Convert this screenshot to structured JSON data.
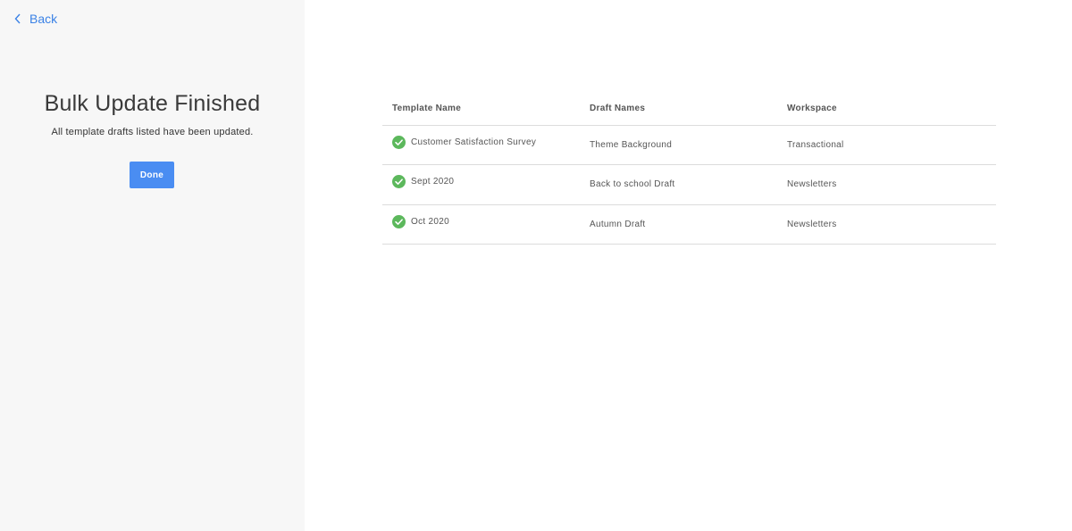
{
  "sidebar": {
    "back_label": "Back",
    "title": "Bulk Update Finished",
    "subtitle": "All template drafts listed have been updated.",
    "done_label": "Done"
  },
  "table": {
    "headers": [
      "Template Name",
      "Draft Names",
      "Workspace"
    ],
    "rows": [
      {
        "template": "Customer Satisfaction Survey",
        "draft": "Theme Background",
        "workspace": "Transactional",
        "status_icon": "check-circle-icon"
      },
      {
        "template": "Sept 2020",
        "draft": "Back to school Draft",
        "workspace": "Newsletters",
        "status_icon": "check-circle-icon"
      },
      {
        "template": "Oct 2020",
        "draft": "Autumn Draft",
        "workspace": "Newsletters",
        "status_icon": "check-circle-icon"
      }
    ]
  },
  "colors": {
    "accent": "#4a8df2",
    "link": "#3b82e6",
    "success": "#5cb85c",
    "sidebar_bg": "#f7f7f7"
  }
}
